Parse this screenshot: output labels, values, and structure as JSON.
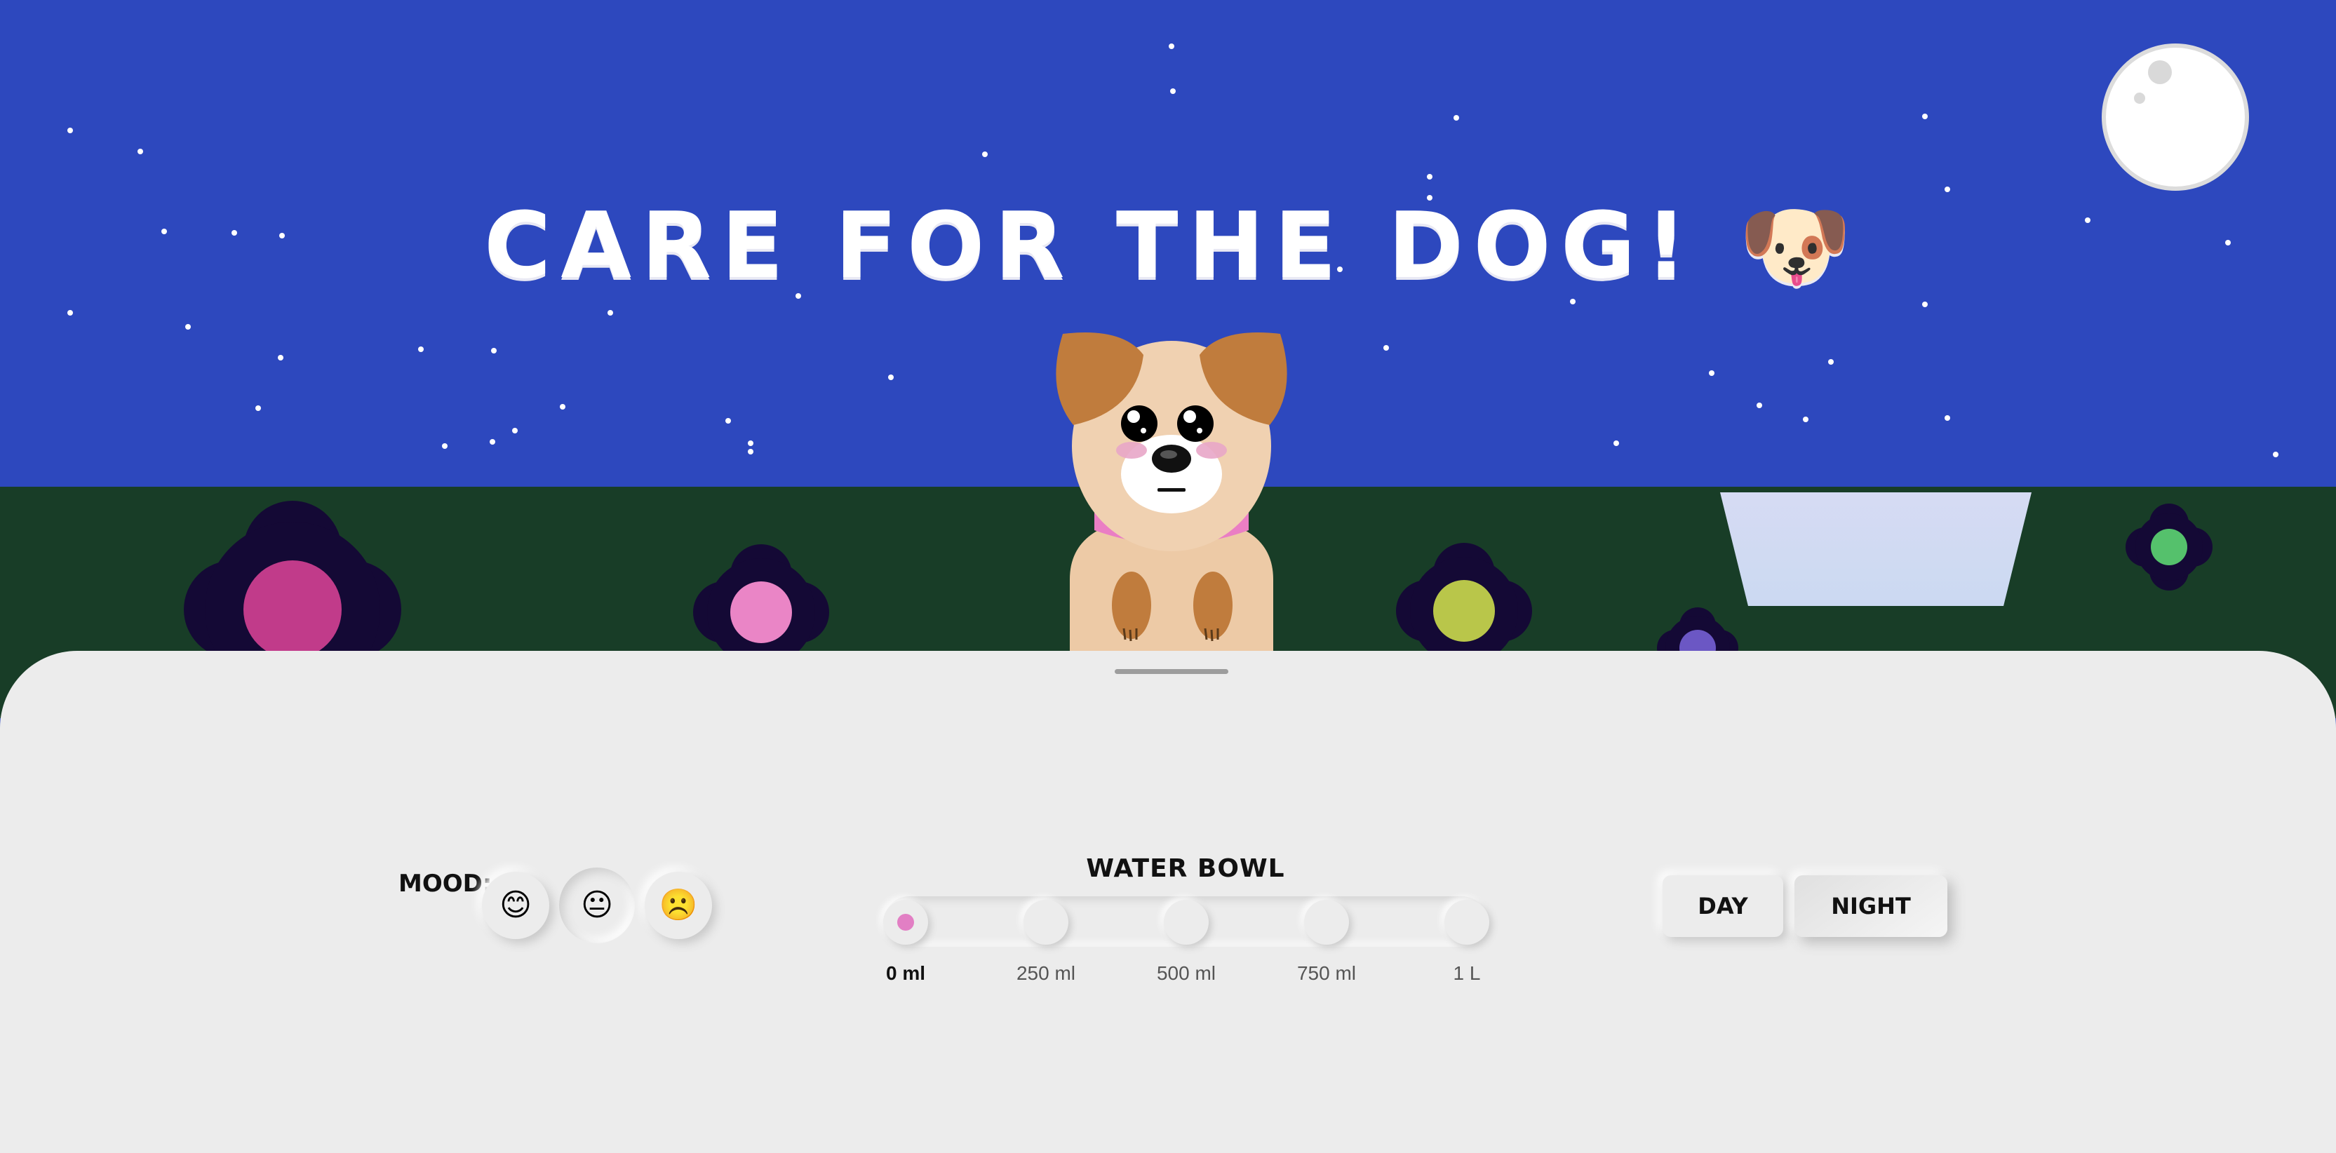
{
  "header": {
    "title": "CARE FOR THE DOG!",
    "title_emoji": "🐶"
  },
  "scene": {
    "time_of_day": "night",
    "colors": {
      "sky": "#2d48be",
      "grass": "#183d27",
      "panel": "#ececec",
      "accent": "#e27fc4"
    }
  },
  "mood": {
    "label": "MOOD:",
    "options": [
      {
        "emoji": "😊",
        "name": "happy"
      },
      {
        "emoji": "😐",
        "name": "neutral",
        "selected": true
      },
      {
        "emoji": "☹️",
        "name": "sad"
      }
    ]
  },
  "water_bowl": {
    "title": "WATER BOWL",
    "options": [
      "0 ml",
      "250 ml",
      "500 ml",
      "750 ml",
      "1 L"
    ],
    "selected_index": 0
  },
  "time_toggle": {
    "day_label": "DAY",
    "night_label": "NIGHT",
    "selected": "night"
  }
}
